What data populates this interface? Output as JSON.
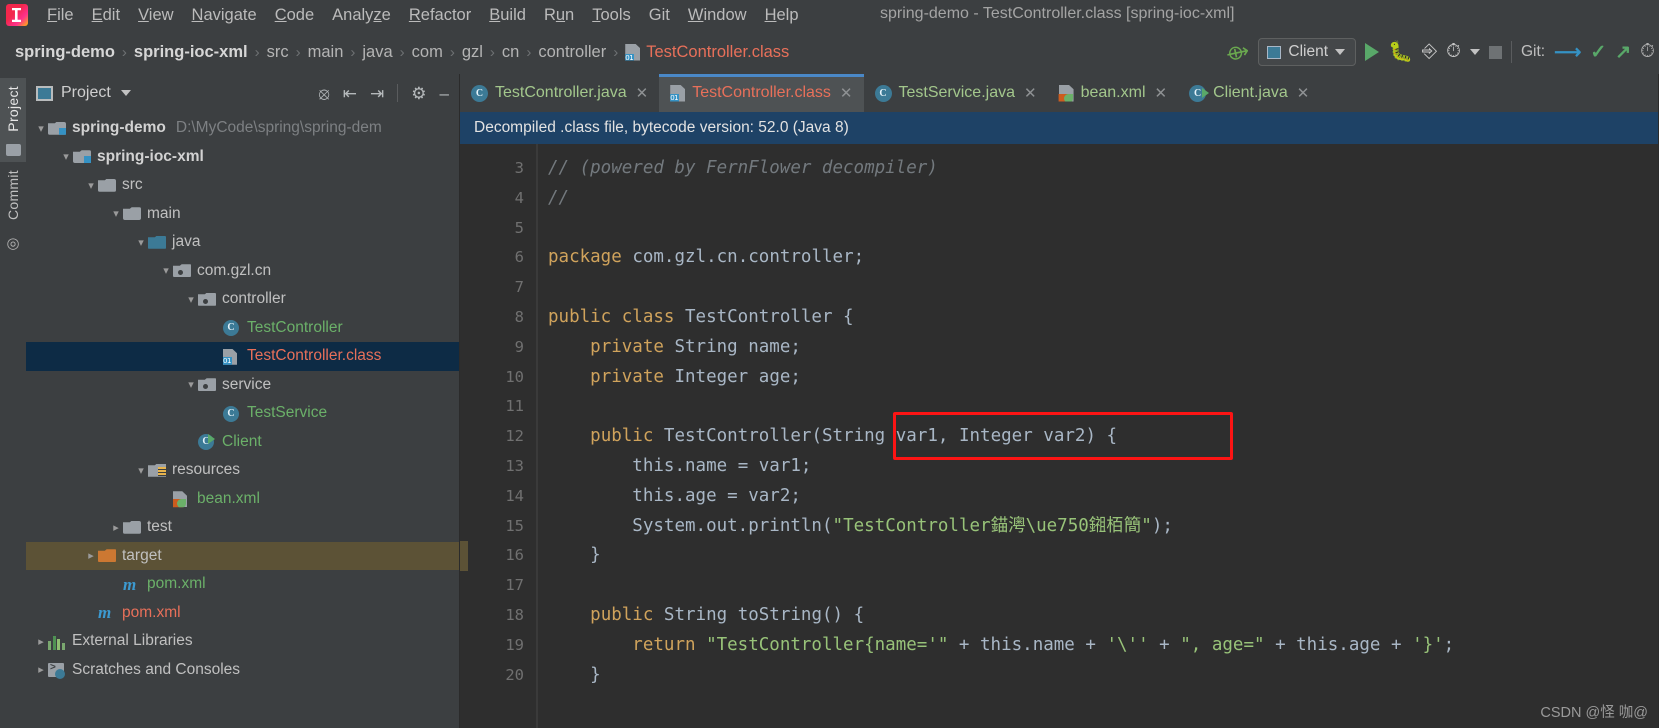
{
  "window": {
    "title": "spring-demo - TestController.class [spring-ioc-xml]"
  },
  "menubar": {
    "items": [
      {
        "label": "File",
        "mnemonic": "F"
      },
      {
        "label": "Edit",
        "mnemonic": "E"
      },
      {
        "label": "View",
        "mnemonic": "V"
      },
      {
        "label": "Navigate",
        "mnemonic": "N"
      },
      {
        "label": "Code",
        "mnemonic": "C"
      },
      {
        "label": "Analyze",
        "mnemonic": "z"
      },
      {
        "label": "Refactor",
        "mnemonic": "R"
      },
      {
        "label": "Build",
        "mnemonic": "B"
      },
      {
        "label": "Run",
        "mnemonic": "u"
      },
      {
        "label": "Tools",
        "mnemonic": "T"
      },
      {
        "label": "Git",
        "mnemonic": ""
      },
      {
        "label": "Window",
        "mnemonic": "W"
      },
      {
        "label": "Help",
        "mnemonic": "H"
      }
    ]
  },
  "navbar": {
    "breadcrumbs": [
      {
        "label": "spring-demo",
        "style": "bold"
      },
      {
        "label": "spring-ioc-xml",
        "style": "bold"
      },
      {
        "label": "src",
        "style": "normal"
      },
      {
        "label": "main",
        "style": "normal"
      },
      {
        "label": "java",
        "style": "normal"
      },
      {
        "label": "com",
        "style": "normal"
      },
      {
        "label": "gzl",
        "style": "normal"
      },
      {
        "label": "cn",
        "style": "normal"
      },
      {
        "label": "controller",
        "style": "normal"
      },
      {
        "label": "TestController.class",
        "style": "file"
      }
    ],
    "separator": "›",
    "run_config": "Client",
    "git_label": "Git:",
    "icons": {
      "build": "hammer-icon",
      "run": "run-icon",
      "debug": "debug-icon",
      "run_with_coverage": "coverage-icon",
      "profiler": "profiler-icon",
      "stop": "stop-icon",
      "git_update": "git-update-icon",
      "git_commit": "git-commit-icon",
      "git_push": "git-push-icon",
      "git_history": "git-history-icon"
    }
  },
  "left_strip": {
    "tabs": [
      {
        "label": "Project",
        "active": true
      },
      {
        "label": "Commit",
        "active": false
      }
    ]
  },
  "project_panel": {
    "title": "Project",
    "toolbar_icons": [
      "locate-icon",
      "expand-all-icon",
      "collapse-all-icon",
      "gear-icon",
      "hide-icon"
    ],
    "tree": [
      {
        "indent": 0,
        "arrow": "⌄",
        "icon": "module-folder",
        "label": "spring-demo",
        "style": "bold",
        "path": "D:\\MyCode\\spring\\spring-dem",
        "state": "normal"
      },
      {
        "indent": 1,
        "arrow": "⌄",
        "icon": "module-folder",
        "label": "spring-ioc-xml",
        "style": "bold",
        "path": "",
        "state": "normal"
      },
      {
        "indent": 2,
        "arrow": "⌄",
        "icon": "folder-grey",
        "label": "src",
        "style": "normal",
        "path": "",
        "state": "normal"
      },
      {
        "indent": 3,
        "arrow": "⌄",
        "icon": "folder-grey",
        "label": "main",
        "style": "normal",
        "path": "",
        "state": "normal"
      },
      {
        "indent": 4,
        "arrow": "⌄",
        "icon": "folder-blue",
        "label": "java",
        "style": "normal",
        "path": "",
        "state": "normal"
      },
      {
        "indent": 5,
        "arrow": "⌄",
        "icon": "package",
        "label": "com.gzl.cn",
        "style": "normal",
        "path": "",
        "state": "normal"
      },
      {
        "indent": 6,
        "arrow": "⌄",
        "icon": "package",
        "label": "controller",
        "style": "normal",
        "path": "",
        "state": "normal"
      },
      {
        "indent": 7,
        "arrow": "",
        "icon": "class-java",
        "label": "TestController",
        "style": "green",
        "path": "",
        "state": "normal"
      },
      {
        "indent": 7,
        "arrow": "",
        "icon": "class-file",
        "label": "TestController.class",
        "style": "red",
        "path": "",
        "state": "selected"
      },
      {
        "indent": 6,
        "arrow": "⌄",
        "icon": "package",
        "label": "service",
        "style": "normal",
        "path": "",
        "state": "normal"
      },
      {
        "indent": 7,
        "arrow": "",
        "icon": "class-java",
        "label": "TestService",
        "style": "green",
        "path": "",
        "state": "normal"
      },
      {
        "indent": 6,
        "arrow": "",
        "icon": "class-runnable",
        "label": "Client",
        "style": "green",
        "path": "",
        "state": "normal"
      },
      {
        "indent": 4,
        "arrow": "⌄",
        "icon": "folder-resources",
        "label": "resources",
        "style": "normal",
        "path": "",
        "state": "normal"
      },
      {
        "indent": 5,
        "arrow": "",
        "icon": "spring-xml",
        "label": "bean.xml",
        "style": "green",
        "path": "",
        "state": "normal"
      },
      {
        "indent": 3,
        "arrow": "›",
        "icon": "folder-grey",
        "label": "test",
        "style": "normal",
        "path": "",
        "state": "normal"
      },
      {
        "indent": 2,
        "arrow": "›",
        "icon": "folder-orange",
        "label": "target",
        "style": "normal",
        "path": "",
        "state": "highlighted"
      },
      {
        "indent": 3,
        "arrow": "",
        "icon": "maven",
        "label": "pom.xml",
        "style": "green",
        "path": "",
        "state": "normal"
      },
      {
        "indent": 2,
        "arrow": "",
        "icon": "maven",
        "label": "pom.xml",
        "style": "red",
        "path": "",
        "state": "normal"
      },
      {
        "indent": 0,
        "arrow": "›",
        "icon": "libraries",
        "label": "External Libraries",
        "style": "normal",
        "path": "",
        "state": "normal"
      },
      {
        "indent": 0,
        "arrow": "›",
        "icon": "scratches",
        "label": "Scratches and Consoles",
        "style": "normal",
        "path": "",
        "state": "normal"
      }
    ]
  },
  "editor": {
    "tabs": [
      {
        "label": "TestController.java",
        "icon": "class-java",
        "active": false
      },
      {
        "label": "TestController.class",
        "icon": "class-file",
        "active": true
      },
      {
        "label": "TestService.java",
        "icon": "class-java",
        "active": false
      },
      {
        "label": "bean.xml",
        "icon": "spring-xml",
        "active": false
      },
      {
        "label": "Client.java",
        "icon": "class-runnable",
        "active": false
      }
    ],
    "close_glyph": "✕",
    "notice": "Decompiled .class file, bytecode version: 52.0 (Java 8)",
    "line_numbers": [
      "3",
      "4",
      "5",
      "6",
      "7",
      "8",
      "9",
      "10",
      "11",
      "12",
      "13",
      "14",
      "15",
      "16",
      "17",
      "18",
      "19",
      "20"
    ],
    "code_lines": [
      "// (powered by FernFlower decompiler)",
      "//",
      "",
      "package com.gzl.cn.controller;",
      "",
      "public class TestController {",
      "    private String name;",
      "    private Integer age;",
      "",
      "    public TestController(String var1, Integer var2) {",
      "        this.name = var1;",
      "        this.age = var2;",
      "        System.out.println(\"TestController錨澚\\ue750鎺栢簡\");",
      "    }",
      "",
      "    public String toString() {",
      "        return \"TestController{name='\" + this.name + '\\'' + \", age=\" + this.age + '}';",
      "    }"
    ],
    "annotation": {
      "type": "red-rectangle",
      "color": "#fc1414"
    },
    "watermark": "CSDN @怪 咖@"
  }
}
